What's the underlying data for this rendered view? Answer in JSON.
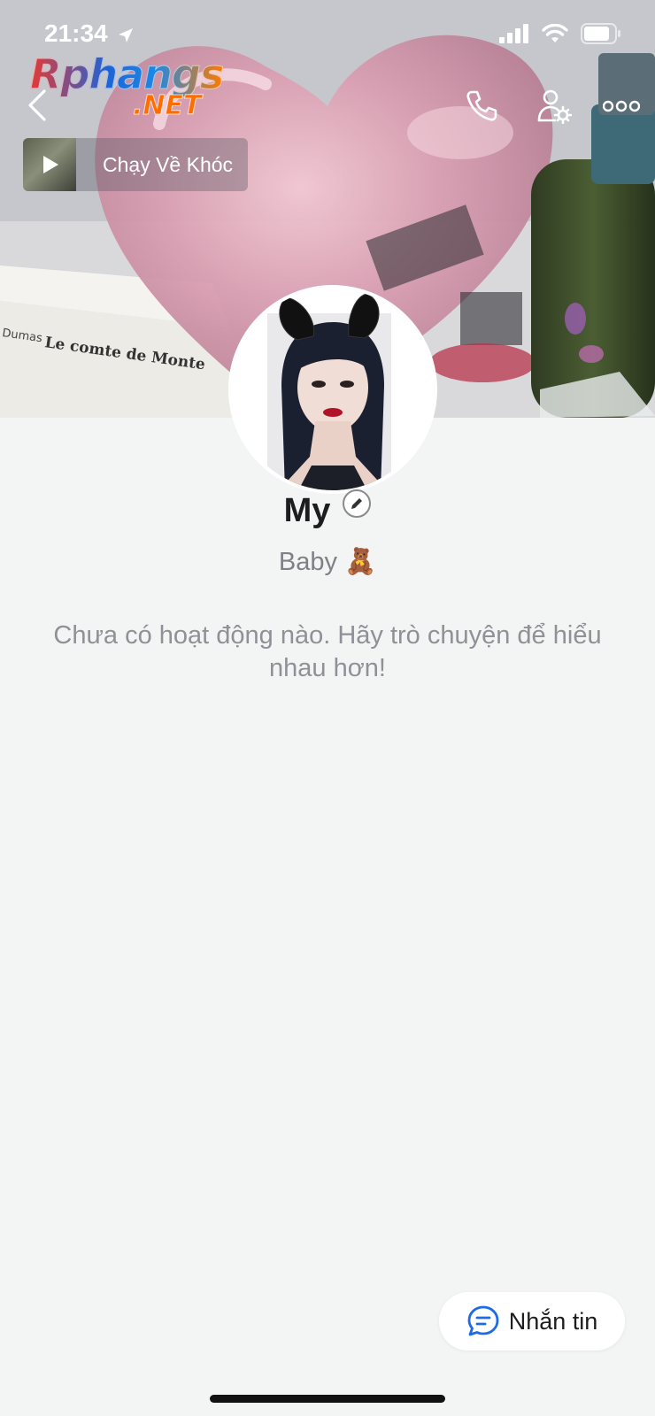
{
  "status_bar": {
    "time": "21:34",
    "icons": [
      "location-arrow-icon",
      "signal-icon",
      "wifi-icon",
      "battery-icon"
    ]
  },
  "watermark": {
    "main": "Rphangs",
    "sub": ".NET"
  },
  "nav": {
    "icons": [
      "chevron-left-icon",
      "phone-icon",
      "user-settings-icon",
      "more-icon"
    ]
  },
  "music": {
    "title": "Chạy Về Khóc"
  },
  "cover": {
    "book_text": "Le comte de Monte",
    "author_text": "Dumas"
  },
  "profile": {
    "name": "My",
    "bio": "Baby 🧸"
  },
  "activity": {
    "empty_message": "Chưa có hoạt động nào. Hãy trò chuyện để hiểu nhau hơn!"
  },
  "message_button": {
    "label": "Nhắn tin"
  },
  "colors": {
    "background": "#f3f5f5",
    "accent": "#1e6be8",
    "text_primary": "#1d1d1f",
    "text_secondary": "#8e9196"
  }
}
